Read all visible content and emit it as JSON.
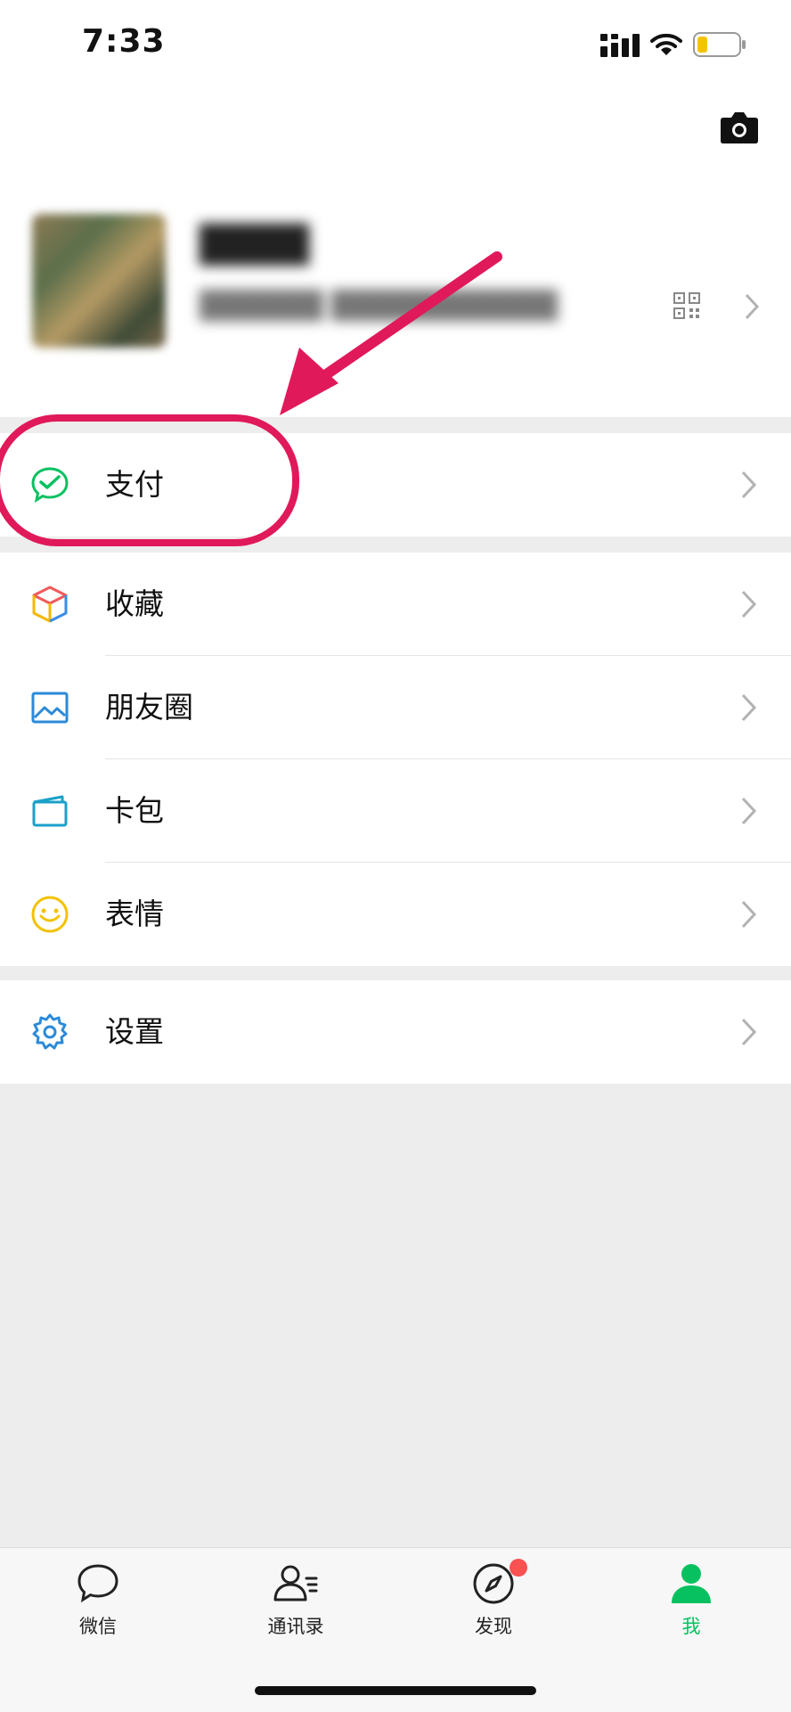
{
  "status_bar": {
    "time": "7:33"
  },
  "profile": {
    "nickname": "████",
    "wechat_id": "██████ ███████████"
  },
  "menu": {
    "pay": "支付",
    "favorites": "收藏",
    "moments": "朋友圈",
    "cards": "卡包",
    "stickers": "表情",
    "settings": "设置"
  },
  "tabs": [
    {
      "label": "微信",
      "icon": "chat-bubble-icon",
      "active": false
    },
    {
      "label": "通讯录",
      "icon": "contacts-icon",
      "active": false
    },
    {
      "label": "发现",
      "icon": "compass-icon",
      "active": false,
      "badge": true
    },
    {
      "label": "我",
      "icon": "person-icon",
      "active": true
    }
  ],
  "colors": {
    "accent_green": "#07c160",
    "annotation_red": "#e0195a",
    "badge_red": "#fa5151"
  }
}
